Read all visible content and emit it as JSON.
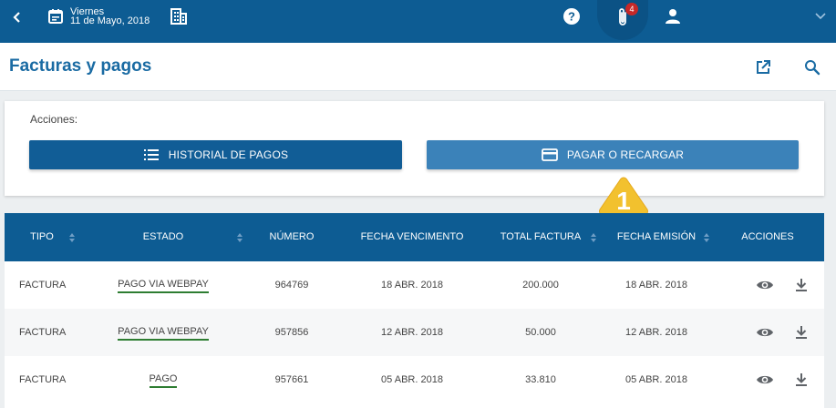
{
  "topbar": {
    "day": "Viernes",
    "date": "11 de Mayo, 2018",
    "attachments_count": "4",
    "icons": [
      "back-icon",
      "calendar-icon",
      "building-icon",
      "help-icon",
      "paperclip-icon",
      "user-icon",
      "chevron-down-icon"
    ],
    "color": "#0d5c93"
  },
  "page": {
    "title": "Facturas y pagos",
    "icons": [
      "external-link-icon",
      "search-icon"
    ]
  },
  "actions": {
    "label": "Acciones:",
    "history_button": "HISTORIAL DE PAGOS",
    "pay_button": "PAGAR O RECARGAR",
    "marker": "1"
  },
  "table": {
    "headers": [
      "TIPO",
      "ESTADO",
      "NÚMERO",
      "FECHA VENCIMENTO",
      "TOTAL FACTURA",
      "FECHA EMISIÓN",
      "ACCIONES"
    ],
    "rows": [
      {
        "tipo": "FACTURA",
        "estado": "PAGO VIA WEBPAY",
        "numero": "964769",
        "vencimiento": "18 ABR. 2018",
        "total": "200.000",
        "emision": "18 ABR. 2018"
      },
      {
        "tipo": "FACTURA",
        "estado": "PAGO VIA WEBPAY",
        "numero": "957856",
        "vencimiento": "12 ABR. 2018",
        "total": "50.000",
        "emision": "12 ABR. 2018"
      },
      {
        "tipo": "FACTURA",
        "estado": "PAGO",
        "numero": "957661",
        "vencimiento": "05 ABR. 2018",
        "total": "33.810",
        "emision": "05 ABR. 2018"
      }
    ],
    "status_underline_color": "#2e7d32",
    "row_action_icons": [
      "view-icon",
      "download-icon"
    ]
  }
}
